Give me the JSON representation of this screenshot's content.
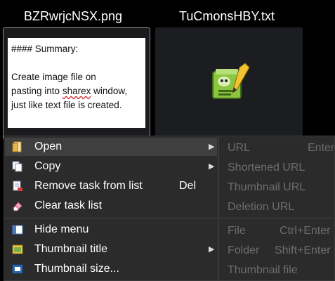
{
  "thumbnails": [
    {
      "title": "BZRwrjcNSX.png",
      "preview_lines": [
        "#### Summary:",
        "Create image file on",
        "pasting into ",
        "sharex",
        " window,",
        "just like text file is created."
      ]
    },
    {
      "title": "TuCmonsHBY.txt",
      "icon": "text-editor-app-icon"
    }
  ],
  "context_menu": {
    "items": [
      {
        "label": "Open",
        "icon": "open-file-icon",
        "has_submenu": true
      },
      {
        "label": "Copy",
        "icon": "copy-icon",
        "has_submenu": true
      },
      {
        "label": "Remove task from list",
        "icon": "remove-task-icon",
        "shortcut": "Del"
      },
      {
        "label": "Clear task list",
        "icon": "eraser-icon"
      },
      {
        "label": "Hide menu",
        "icon": "hide-menu-icon"
      },
      {
        "label": "Thumbnail title",
        "icon": "thumbnail-title-icon",
        "has_submenu": true
      },
      {
        "label": "Thumbnail size...",
        "icon": "thumbnail-size-icon"
      }
    ]
  },
  "open_submenu": {
    "items": [
      {
        "label": "URL",
        "shortcut": "Enter"
      },
      {
        "label": "Shortened URL"
      },
      {
        "label": "Thumbnail URL"
      },
      {
        "label": "Deletion URL"
      },
      {
        "label": "File",
        "shortcut": "Ctrl+Enter"
      },
      {
        "label": "Folder",
        "shortcut": "Shift+Enter"
      },
      {
        "label": "Thumbnail file"
      }
    ]
  },
  "colors": {
    "background": "#000000",
    "menu_bg": "#2b2b2b",
    "highlight": "#3f3f3f",
    "disabled_text": "#6d6d6d"
  }
}
